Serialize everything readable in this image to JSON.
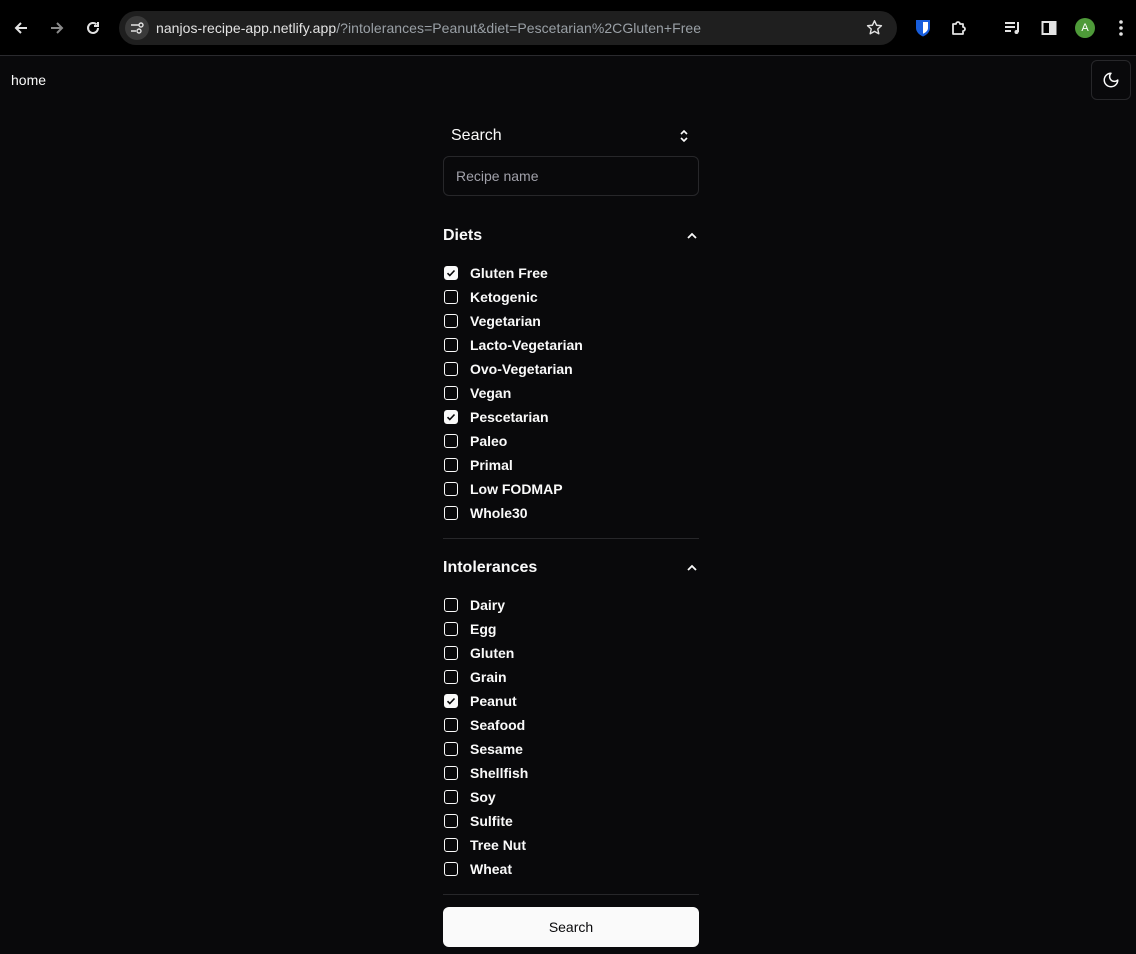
{
  "browser": {
    "url_host": "nanjos-recipe-app.netlify.app",
    "url_rest": "/?intolerances=Peanut&diet=Pescetarian%2CGluten+Free",
    "profile_initial": "A"
  },
  "page": {
    "home_link": "home"
  },
  "search": {
    "select_value": "Search",
    "input_placeholder": "Recipe name",
    "submit_label": "Search"
  },
  "diets": {
    "title": "Diets",
    "items": [
      {
        "label": "Gluten Free",
        "checked": true
      },
      {
        "label": "Ketogenic",
        "checked": false
      },
      {
        "label": "Vegetarian",
        "checked": false
      },
      {
        "label": "Lacto-Vegetarian",
        "checked": false
      },
      {
        "label": "Ovo-Vegetarian",
        "checked": false
      },
      {
        "label": "Vegan",
        "checked": false
      },
      {
        "label": "Pescetarian",
        "checked": true
      },
      {
        "label": "Paleo",
        "checked": false
      },
      {
        "label": "Primal",
        "checked": false
      },
      {
        "label": "Low FODMAP",
        "checked": false
      },
      {
        "label": "Whole30",
        "checked": false
      }
    ]
  },
  "intolerances": {
    "title": "Intolerances",
    "items": [
      {
        "label": "Dairy",
        "checked": false
      },
      {
        "label": "Egg",
        "checked": false
      },
      {
        "label": "Gluten",
        "checked": false
      },
      {
        "label": "Grain",
        "checked": false
      },
      {
        "label": "Peanut",
        "checked": true
      },
      {
        "label": "Seafood",
        "checked": false
      },
      {
        "label": "Sesame",
        "checked": false
      },
      {
        "label": "Shellfish",
        "checked": false
      },
      {
        "label": "Soy",
        "checked": false
      },
      {
        "label": "Sulfite",
        "checked": false
      },
      {
        "label": "Tree Nut",
        "checked": false
      },
      {
        "label": "Wheat",
        "checked": false
      }
    ]
  }
}
